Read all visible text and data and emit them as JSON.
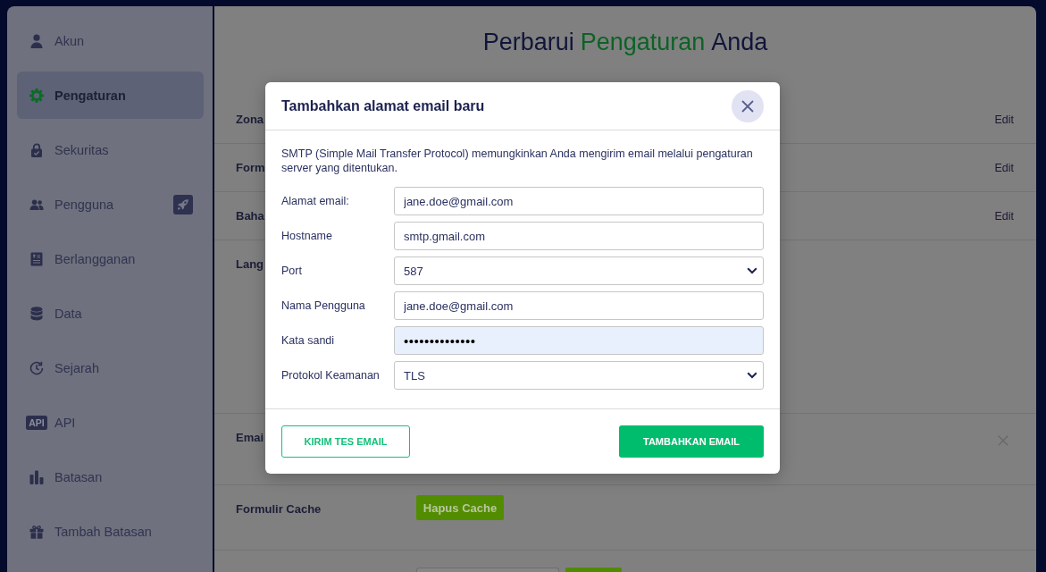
{
  "sidebar": {
    "items": [
      {
        "label": "Akun",
        "selected": false,
        "badge": false
      },
      {
        "label": "Pengaturan",
        "selected": true,
        "badge": false
      },
      {
        "label": "Sekuritas",
        "selected": false,
        "badge": false
      },
      {
        "label": "Pengguna",
        "selected": false,
        "badge": true
      },
      {
        "label": "Berlangganan",
        "selected": false,
        "badge": false
      },
      {
        "label": "Data",
        "selected": false,
        "badge": false
      },
      {
        "label": "Sejarah",
        "selected": false,
        "badge": false
      },
      {
        "label": "API",
        "selected": false,
        "badge": false,
        "icon_text": "API"
      },
      {
        "label": "Batasan",
        "selected": false,
        "badge": false
      },
      {
        "label": "Tambah Batasan",
        "selected": false,
        "badge": false
      }
    ]
  },
  "page": {
    "title": {
      "before": "Perbarui",
      "highlight": "Pengaturan",
      "after": "Anda"
    },
    "rows": [
      {
        "kind": "edit",
        "label": "Zona",
        "action": "Edit"
      },
      {
        "kind": "edit",
        "label": "Form",
        "action": "Edit"
      },
      {
        "kind": "edit",
        "label": "Baha",
        "action": "Edit"
      },
      {
        "kind": "tall",
        "label": "Lang"
      },
      {
        "kind": "removable",
        "label": "Emai"
      },
      {
        "kind": "button",
        "label": "Formulir Cache",
        "button": "Hapus Cache"
      },
      {
        "kind": "input_button"
      }
    ]
  },
  "modal": {
    "title": "Tambahkan alamat email baru",
    "description": "SMTP (Simple Mail Transfer Protocol) memungkinkan Anda mengirim email melalui pengaturan server yang ditentukan.",
    "fields": [
      {
        "label": "Alamat email:",
        "kind": "input",
        "value": "jane.doe@gmail.com",
        "autofilled": false
      },
      {
        "label": "Hostname",
        "kind": "input",
        "value": "smtp.gmail.com",
        "autofilled": false
      },
      {
        "label": "Port",
        "kind": "select",
        "value": "587",
        "autofilled": false
      },
      {
        "label": "Nama Pengguna",
        "kind": "input",
        "value": "jane.doe@gmail.com",
        "autofilled": false
      },
      {
        "label": "Kata sandi",
        "kind": "password",
        "value": "••••••••••••••",
        "autofilled": true
      },
      {
        "label": "Protokol Keamanan",
        "kind": "select",
        "value": "TLS",
        "autofilled": false
      }
    ],
    "buttons": [
      {
        "label": "KIRIM TES EMAIL",
        "kind": "outline"
      },
      {
        "label": "TAMBAHKAN EMAIL",
        "kind": "primary"
      }
    ]
  }
}
